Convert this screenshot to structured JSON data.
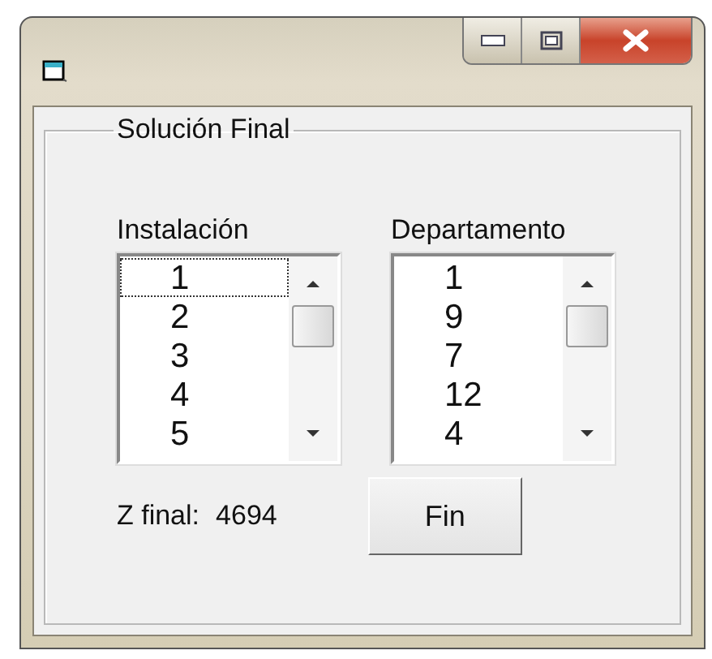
{
  "group": {
    "title": "Solución Final"
  },
  "lists": [
    {
      "label": "Instalación",
      "items": [
        {
          "text": "1",
          "focused": true
        },
        {
          "text": "2",
          "focused": false
        },
        {
          "text": "3",
          "focused": false
        },
        {
          "text": "4",
          "focused": false
        },
        {
          "text": "5",
          "focused": false
        }
      ]
    },
    {
      "label": "Departamento",
      "items": [
        {
          "text": "1",
          "focused": false
        },
        {
          "text": "9",
          "focused": false
        },
        {
          "text": "7",
          "focused": false
        },
        {
          "text": "12",
          "focused": false
        },
        {
          "text": "4",
          "focused": false
        }
      ]
    }
  ],
  "result": {
    "label": "Z final:",
    "value": "4694"
  },
  "buttons": [
    "Fin"
  ]
}
